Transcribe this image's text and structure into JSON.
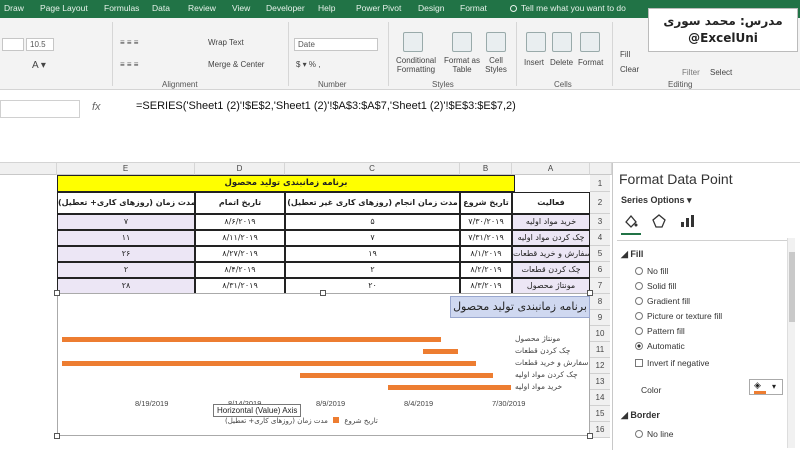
{
  "ribbon_tabs": [
    "Draw",
    "Page Layout",
    "Formulas",
    "Data",
    "Review",
    "View",
    "Developer",
    "Help",
    "Power Pivot",
    "Design",
    "Format"
  ],
  "tell_me": "Tell me what you want to do",
  "watermark": {
    "line1": "مدرس: محمد سوری",
    "line2": "@ExcelUni"
  },
  "ribbon": {
    "font_size": "10.5",
    "wrap_text": "Wrap Text",
    "merge_center": "Merge & Center",
    "number_format": "Date",
    "alignment": "Alignment",
    "number": "Number",
    "styles": "Styles",
    "cells": "Cells",
    "editing": "Editing",
    "conditional_formatting": "Conditional Formatting",
    "format_as_table": "Format as Table",
    "cell_styles": "Cell Styles",
    "insert": "Insert",
    "delete": "Delete",
    "format": "Format",
    "fill": "Fill",
    "clear": "Clear",
    "filter": "Filter",
    "select": "Select"
  },
  "formula_bar": {
    "fx": "fx",
    "formula": "=SERIES('Sheet1 (2)'!$E$2,'Sheet1 (2)'!$A$3:$A$7,'Sheet1 (2)'!$E$3:$E$7,2)"
  },
  "columns": [
    "E",
    "D",
    "C",
    "B",
    "A"
  ],
  "rows": [
    "1",
    "2",
    "3",
    "4",
    "5",
    "6",
    "7",
    "8",
    "9",
    "10",
    "11",
    "12",
    "13",
    "14",
    "15",
    "16"
  ],
  "table": {
    "title": "برنامه زمانبندی تولید محصول",
    "headers": {
      "A": "فعالیت",
      "B": "تاریخ شروع",
      "C": "مدت زمان انجام (روزهای کاری غیر تعطیل)",
      "D": "تاریخ اتمام",
      "E": "مدت زمان (روزهای کاری+ تعطیل)"
    },
    "rows": [
      {
        "A": "خرید مواد اولیه",
        "B": "۷/۳۰/۲۰۱۹",
        "C": "۵",
        "D": "۸/۶/۲۰۱۹",
        "E": "۷"
      },
      {
        "A": "چک کردن مواد اولیه",
        "B": "۷/۳۱/۲۰۱۹",
        "C": "۷",
        "D": "۸/۱۱/۲۰۱۹",
        "E": "۱۱"
      },
      {
        "A": "سفارش و خرید قطعات",
        "B": "۸/۱/۲۰۱۹",
        "C": "۱۹",
        "D": "۸/۲۷/۲۰۱۹",
        "E": "۲۶"
      },
      {
        "A": "چک کردن قطعات",
        "B": "۸/۲/۲۰۱۹",
        "C": "۲",
        "D": "۸/۴/۲۰۱۹",
        "E": "۲"
      },
      {
        "A": "مونتاژ محصول",
        "B": "۸/۳/۲۰۱۹",
        "C": "۲۰",
        "D": "۸/۳۱/۲۰۱۹",
        "E": "۲۸"
      }
    ]
  },
  "chart_data": {
    "type": "bar",
    "title": "برنامه زمانبندی تولید محصول",
    "categories": [
      "مونتاژ محصول",
      "چک کردن قطعات",
      "سفارش و خرید قطعات",
      "چک کردن مواد اولیه",
      "خرید مواد اولیه"
    ],
    "series": [
      {
        "name": "مدت زمان (روزهای کاری+ تعطیل)",
        "values": [
          28,
          2,
          26,
          11,
          7
        ],
        "color": "#ed7d31"
      }
    ],
    "x_ticks": [
      "8/19/2019",
      "8/14/2019",
      "8/9/2019",
      "8/4/2019",
      "7/30/2019"
    ],
    "x_reversed": true,
    "tooltip": "Horizontal (Value) Axis",
    "legend_partial": "تاریخ شروع",
    "legend_series": "مدت زمان (روزهای کاری+ تعطیل)"
  },
  "pane": {
    "title": "Format Data Point",
    "series_options": "Series Options",
    "fill_section": "Fill",
    "fill_options": [
      "No fill",
      "Solid fill",
      "Gradient fill",
      "Picture or texture fill",
      "Pattern fill",
      "Automatic"
    ],
    "invert": "Invert if negative",
    "color": "Color",
    "border_section": "Border",
    "border_options": [
      "No line"
    ],
    "accent": "#217346"
  }
}
